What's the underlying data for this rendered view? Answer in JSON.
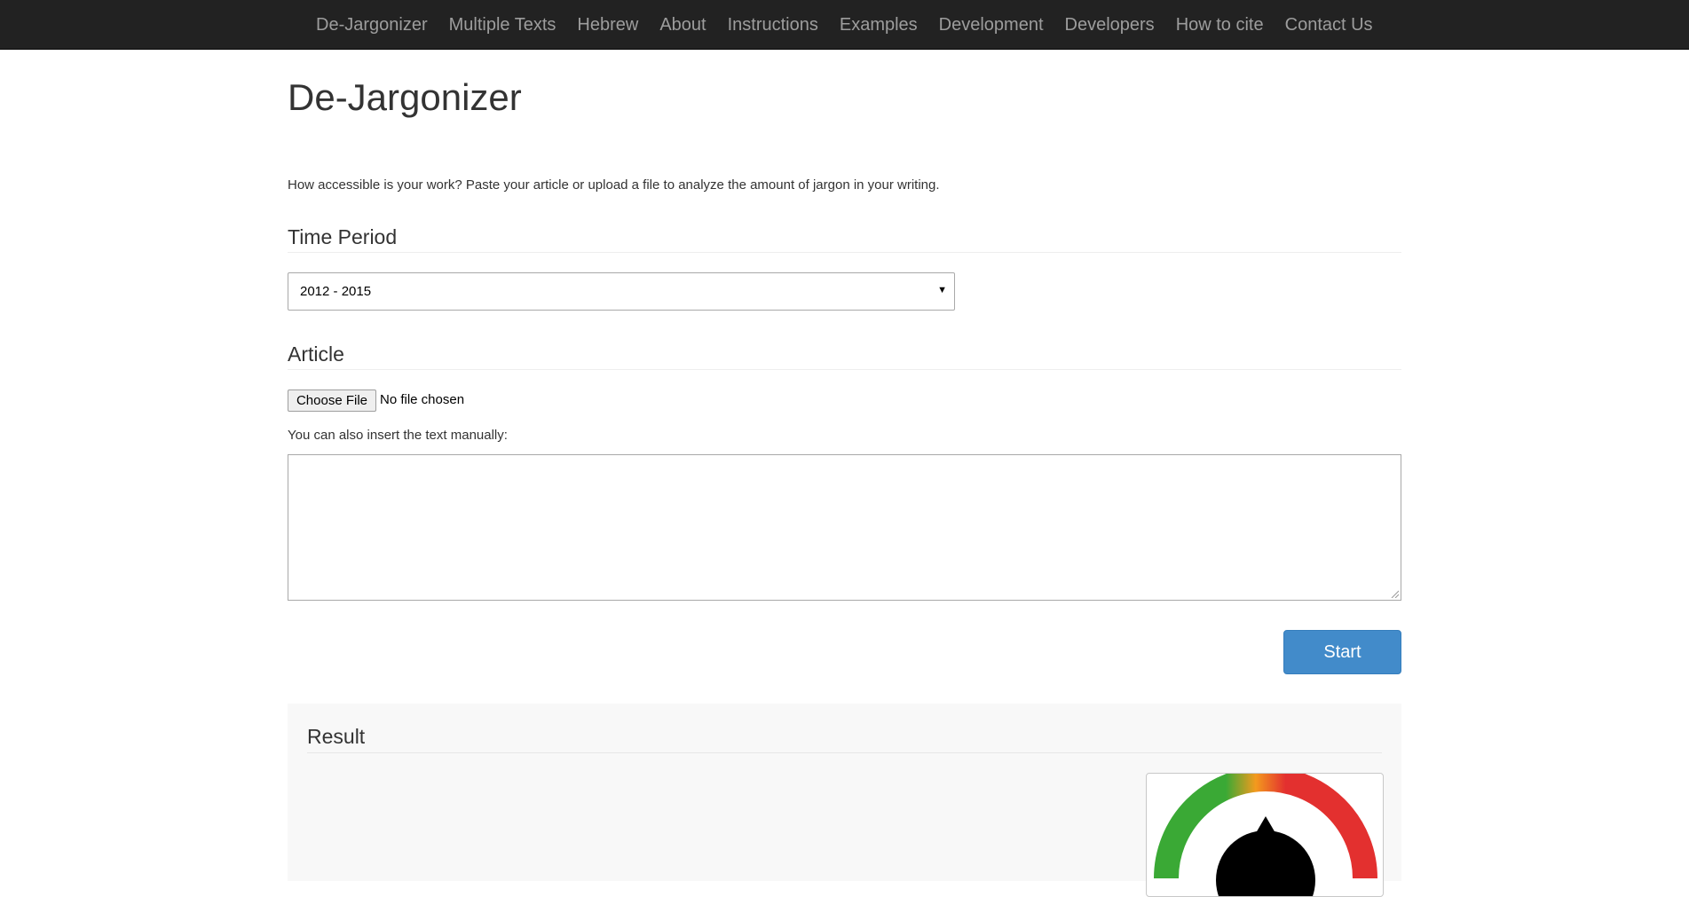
{
  "nav": {
    "items": [
      "De-Jargonizer",
      "Multiple Texts",
      "Hebrew",
      "About",
      "Instructions",
      "Examples",
      "Development",
      "Developers",
      "How to cite",
      "Contact Us"
    ]
  },
  "page": {
    "title": "De-Jargonizer",
    "intro": "How accessible is your work? Paste your article or upload a file to analyze the amount of jargon in your writing."
  },
  "time_period": {
    "heading": "Time Period",
    "selected": "2012 - 2015"
  },
  "article": {
    "heading": "Article",
    "choose_file_label": "Choose File",
    "file_status": "No file chosen",
    "manual_label": "You can also insert the text manually:",
    "text_value": ""
  },
  "start_label": "Start",
  "result": {
    "heading": "Result"
  },
  "colors": {
    "nav_bg": "#222222",
    "nav_text": "#9d9d9d",
    "primary": "#428bca",
    "gauge_green": "#3aa935",
    "gauge_orange": "#f39a1e",
    "gauge_red": "#e3302f"
  }
}
